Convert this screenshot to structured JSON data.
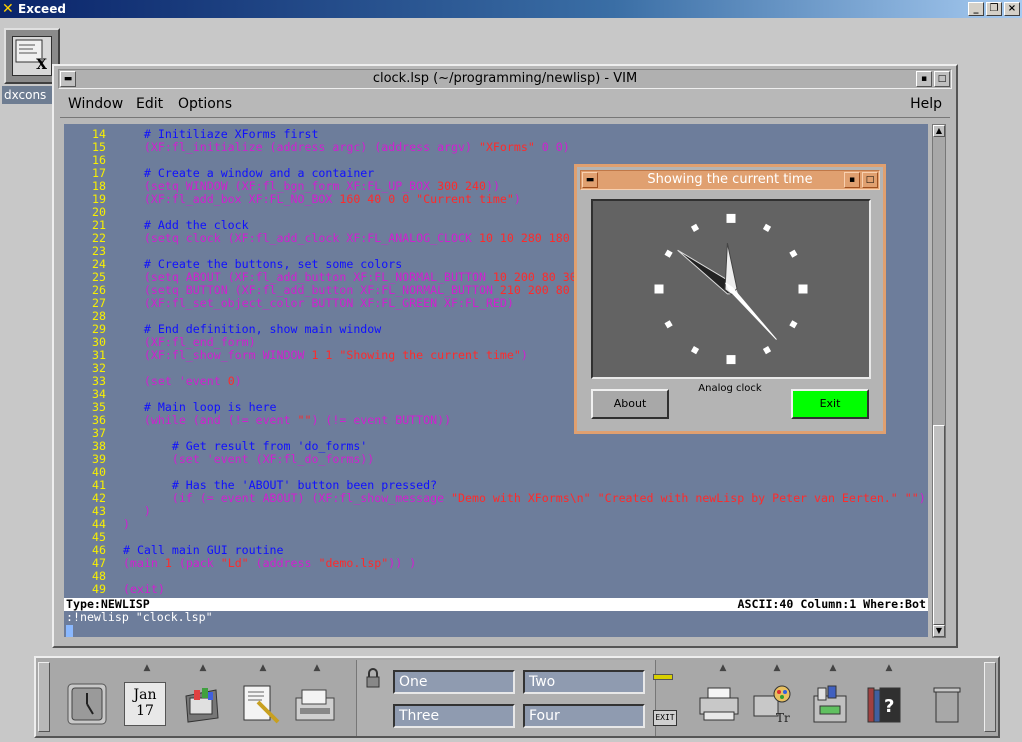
{
  "exceed": {
    "title": "Exceed",
    "logo_icon": "x-logo-icon",
    "minimize": "_",
    "restore": "❐",
    "close": "×"
  },
  "desktop": {
    "console_icon": {
      "label": "dxcons"
    }
  },
  "vim": {
    "title": "clock.lsp (~/programming/newlisp) - VIM",
    "menus": {
      "window": "Window",
      "edit": "Edit",
      "options": "Options",
      "help": "Help"
    },
    "lines": [
      {
        "n": "14",
        "segs": [
          [
            "cm",
            "    # Initiliaze XForms first"
          ]
        ]
      },
      {
        "n": "15",
        "segs": [
          [
            "par",
            "    (XF:fl_initialize (address argc) (address argv) "
          ],
          [
            "str",
            "\"XForms\""
          ],
          [
            "par",
            " 0 0)"
          ]
        ]
      },
      {
        "n": "16",
        "segs": []
      },
      {
        "n": "17",
        "segs": [
          [
            "cm",
            "    # Create a window and a container"
          ]
        ]
      },
      {
        "n": "18",
        "segs": [
          [
            "par",
            "    (setq WINDOW (XF:fl_bgn_form XF:FL_UP_BOX "
          ],
          [
            "str",
            "300 240"
          ],
          [
            "par",
            "))"
          ]
        ]
      },
      {
        "n": "19",
        "segs": [
          [
            "par",
            "    (XF:fl_add_box XF:FL_NO_BOX "
          ],
          [
            "str",
            "160 40 0 0 \"Current time\""
          ],
          [
            "par",
            ")"
          ]
        ]
      },
      {
        "n": "20",
        "segs": []
      },
      {
        "n": "21",
        "segs": [
          [
            "cm",
            "    # Add the clock"
          ]
        ]
      },
      {
        "n": "22",
        "segs": [
          [
            "par",
            "    (setq clock (XF:fl_add_clock XF:FL_ANALOG_CLOCK "
          ],
          [
            "str",
            "10 10 280 180 \"Analog clock\""
          ],
          [
            "par",
            "))"
          ]
        ]
      },
      {
        "n": "23",
        "segs": []
      },
      {
        "n": "24",
        "segs": [
          [
            "cm",
            "    # Create the buttons, set some colors"
          ]
        ]
      },
      {
        "n": "25",
        "segs": [
          [
            "par",
            "    (setq ABOUT (XF:fl_add_button XF:FL_NORMAL_BUTTON "
          ],
          [
            "str",
            "10 200 80 30 \"About\""
          ],
          [
            "par",
            "))"
          ]
        ]
      },
      {
        "n": "26",
        "segs": [
          [
            "par",
            "    (setq BUTTON (XF:fl_add_button XF:FL_NORMAL_BUTTON "
          ],
          [
            "str",
            "210 200 80 30 \"Exit\""
          ],
          [
            "par",
            "))"
          ]
        ]
      },
      {
        "n": "27",
        "segs": [
          [
            "par",
            "    (XF:fl_set_object_color BUTTON XF:FL_GREEN XF:FL_RED)"
          ]
        ]
      },
      {
        "n": "28",
        "segs": []
      },
      {
        "n": "29",
        "segs": [
          [
            "cm",
            "    # End definition, show main window"
          ]
        ]
      },
      {
        "n": "30",
        "segs": [
          [
            "par",
            "    (XF:fl_end_form)"
          ]
        ]
      },
      {
        "n": "31",
        "segs": [
          [
            "par",
            "    (XF:fl_show_form WINDOW "
          ],
          [
            "str",
            "1 1 \"Showing the current time\""
          ],
          [
            "par",
            ")"
          ]
        ]
      },
      {
        "n": "32",
        "segs": []
      },
      {
        "n": "33",
        "segs": [
          [
            "par",
            "    (set 'event "
          ],
          [
            "str",
            "0"
          ],
          [
            "par",
            ")"
          ]
        ]
      },
      {
        "n": "34",
        "segs": []
      },
      {
        "n": "35",
        "segs": [
          [
            "cm",
            "    # Main loop is here"
          ]
        ]
      },
      {
        "n": "36",
        "segs": [
          [
            "par",
            "    (while (and (!= event "
          ],
          [
            "str",
            "\"\""
          ],
          [
            "par",
            ") (!= event BUTTON))"
          ]
        ]
      },
      {
        "n": "37",
        "segs": []
      },
      {
        "n": "38",
        "segs": [
          [
            "cm",
            "        # Get result from 'do_forms'"
          ]
        ]
      },
      {
        "n": "39",
        "segs": [
          [
            "par",
            "        (set 'event (XF:fl_do_forms))"
          ]
        ]
      },
      {
        "n": "40",
        "segs": []
      },
      {
        "n": "41",
        "segs": [
          [
            "cm",
            "        # Has the 'ABOUT' button been pressed?"
          ]
        ]
      },
      {
        "n": "42",
        "segs": [
          [
            "par",
            "        (if (= event ABOUT) (XF:fl_show_message "
          ],
          [
            "str",
            "\"Demo with XForms\\n\" \"Created with newLisp by Peter van Eerten.\" \"\""
          ],
          [
            "par",
            "))"
          ]
        ]
      },
      {
        "n": "43",
        "segs": [
          [
            "par",
            "    )"
          ]
        ]
      },
      {
        "n": "44",
        "segs": [
          [
            "par",
            " )"
          ]
        ]
      },
      {
        "n": "45",
        "segs": []
      },
      {
        "n": "46",
        "segs": [
          [
            "cm",
            " # Call main GUI routine"
          ]
        ]
      },
      {
        "n": "47",
        "segs": [
          [
            "par",
            " (main "
          ],
          [
            "str",
            "1"
          ],
          [
            "par",
            " (pack "
          ],
          [
            "str",
            "\"Ld\""
          ],
          [
            "par",
            " (address "
          ],
          [
            "str",
            "\"demo.lsp\""
          ],
          [
            "par",
            ")) )"
          ]
        ]
      },
      {
        "n": "48",
        "segs": []
      },
      {
        "n": "49",
        "segs": [
          [
            "par",
            " (exit)"
          ]
        ]
      }
    ],
    "status_left": "Type:NEWLISP",
    "status_right": "ASCII:40 Column:1 Where:Bot",
    "command_line": ":!newlisp \"clock.lsp\""
  },
  "clock_window": {
    "title": "Showing the current time",
    "clock_label": "Analog clock",
    "about_label": "About",
    "exit_label": "Exit",
    "time": {
      "hours": 11,
      "minutes": 51,
      "seconds": 23
    }
  },
  "panel": {
    "calendar": {
      "month": "Jan",
      "day": "17"
    },
    "workspaces": [
      "One",
      "Two",
      "Three",
      "Four"
    ],
    "exit_label": "EXIT",
    "icons_left": [
      "clock-icon",
      "calendar-icon",
      "file-manager-icon",
      "text-editor-icon",
      "mailbox-icon"
    ],
    "icons_right": [
      "printer-icon",
      "style-manager-icon",
      "application-manager-icon",
      "help-manager-icon",
      "trash-icon"
    ]
  }
}
